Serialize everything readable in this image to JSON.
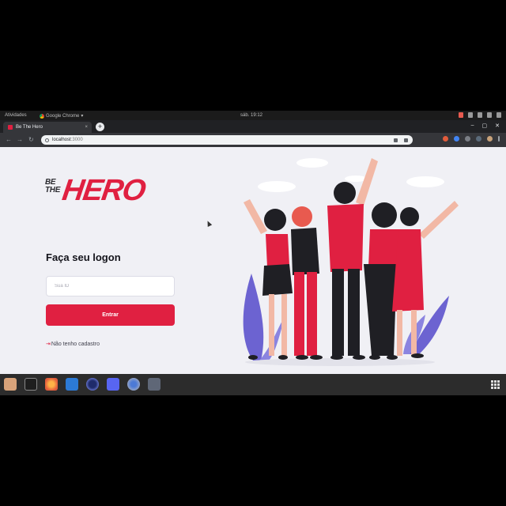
{
  "system_bar": {
    "activities": "Atividades",
    "app_name": "Google Chrome",
    "app_menu_arrow": "▾",
    "clock": "sáb. 19:12"
  },
  "browser": {
    "tab_title": "Be The Hero",
    "tab_close": "×",
    "new_tab": "+",
    "url_host": "localhost",
    "url_port": ":3000",
    "back": "←",
    "forward": "→",
    "reload": "↻",
    "window_controls": [
      "–",
      "▢",
      "✕"
    ]
  },
  "logo": {
    "be": "BE",
    "the": "THE",
    "hero": "HERO"
  },
  "login": {
    "title": "Faça seu logon",
    "id_placeholder": "Sua ID",
    "submit_label": "Entrar",
    "register_icon": "⇥",
    "register_label": "Não tenho cadastro"
  },
  "colors": {
    "brand_red": "#e02041",
    "page_bg": "#f0f0f5",
    "text_dark": "#13131a"
  },
  "taskbar": {
    "apps": [
      "files-icon",
      "terminal-icon",
      "firefox-icon",
      "vscode-icon",
      "eclipse-icon",
      "discord-icon",
      "chrome-icon",
      "vpn-icon"
    ]
  }
}
